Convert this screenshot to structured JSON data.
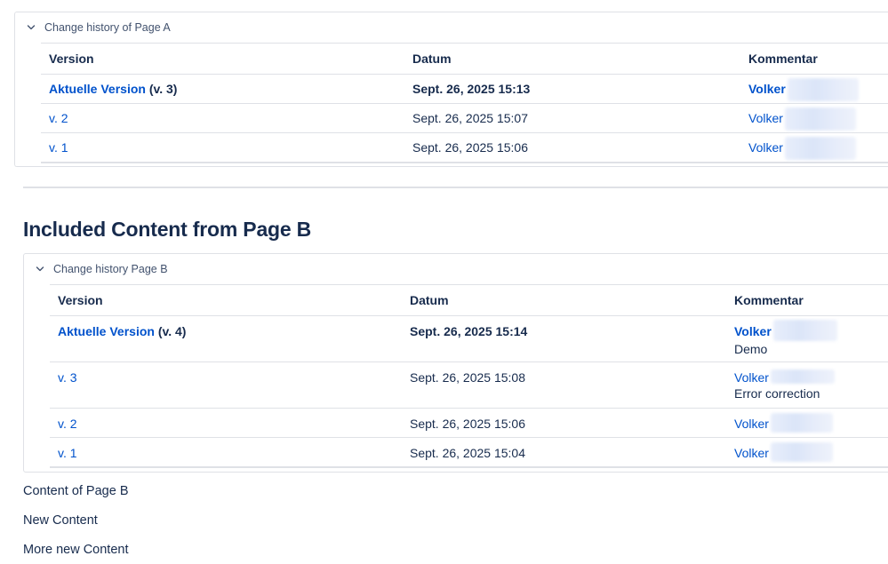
{
  "panel_a": {
    "header": "Change history of Page A",
    "columns": [
      "Version",
      "Datum",
      "Kommentar"
    ],
    "rows": [
      {
        "version_link": "Aktuelle Version",
        "version_suffix": " (v. 3)",
        "date": "Sept. 26, 2025 15:13",
        "author": "Volker",
        "current": true
      },
      {
        "version_link": "v. 2",
        "version_suffix": "",
        "date": "Sept. 26, 2025 15:07",
        "author": "Volker",
        "current": false
      },
      {
        "version_link": "v. 1",
        "version_suffix": "",
        "date": "Sept. 26, 2025 15:06",
        "author": "Volker",
        "current": false
      }
    ]
  },
  "section_heading": "Included Content from Page B",
  "panel_b": {
    "header": "Change history Page B",
    "columns": [
      "Version",
      "Datum",
      "Kommentar"
    ],
    "rows": [
      {
        "version_link": "Aktuelle Version",
        "version_suffix": " (v. 4)",
        "date": "Sept. 26, 2025 15:14",
        "author": "Volker",
        "comment": "Demo",
        "current": true
      },
      {
        "version_link": "v. 3",
        "version_suffix": "",
        "date": "Sept. 26, 2025 15:08",
        "author": "Volker",
        "comment": "Error correction",
        "current": false
      },
      {
        "version_link": "v. 2",
        "version_suffix": "",
        "date": "Sept. 26, 2025 15:06",
        "author": "Volker",
        "comment": "",
        "current": false
      },
      {
        "version_link": "v. 1",
        "version_suffix": "",
        "date": "Sept. 26, 2025 15:04",
        "author": "Volker",
        "comment": "",
        "current": false
      }
    ]
  },
  "paragraphs": [
    "Content of Page B",
    "New Content",
    "More new Content"
  ],
  "colors": {
    "link": "#0052cc",
    "text": "#172b4d",
    "border": "#dfe1e6"
  },
  "icons": {
    "expand": "chevron-down-icon"
  }
}
